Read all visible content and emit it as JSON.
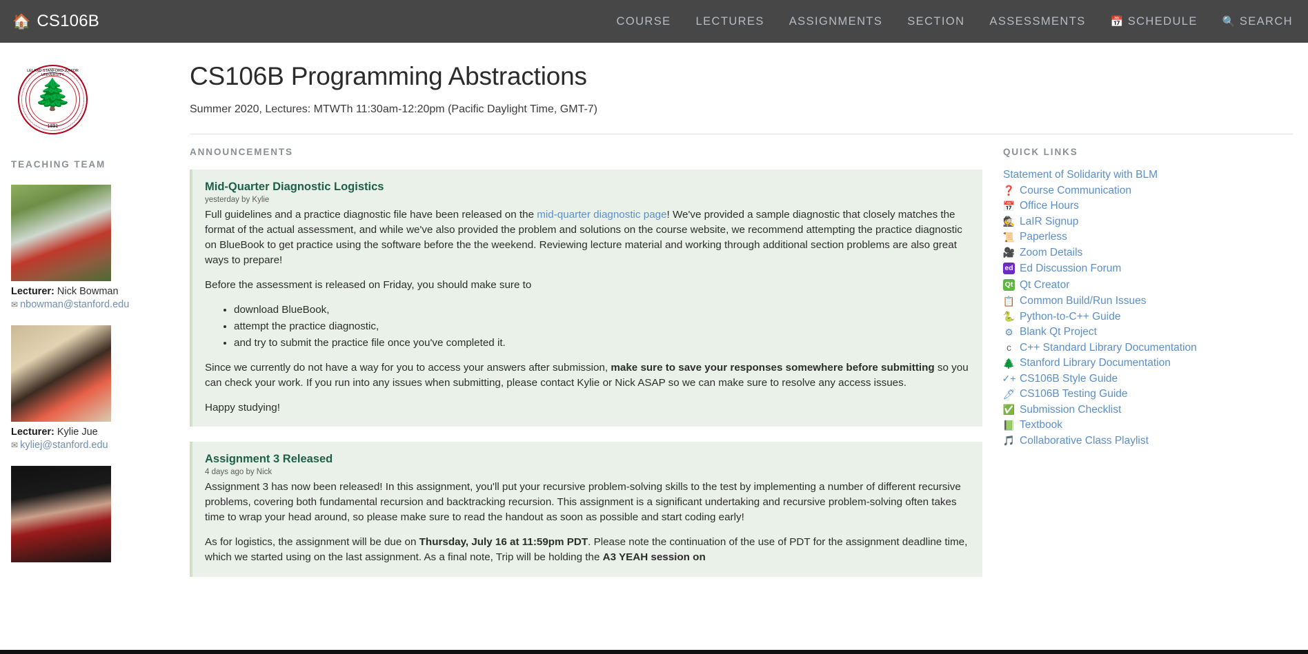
{
  "topnav": {
    "brand": "CS106B",
    "brand_icon": "house-icon",
    "links": [
      {
        "label": "COURSE",
        "icon": ""
      },
      {
        "label": "LECTURES",
        "icon": ""
      },
      {
        "label": "ASSIGNMENTS",
        "icon": ""
      },
      {
        "label": "SECTION",
        "icon": ""
      },
      {
        "label": "ASSESSMENTS",
        "icon": ""
      },
      {
        "label": "SCHEDULE",
        "icon": "📅"
      },
      {
        "label": "SEARCH",
        "icon": "🔍"
      }
    ]
  },
  "sidebar": {
    "logo": {
      "name": "stanford-seal",
      "top_text": "LELAND STANFORD JUNIOR UNIVERSITY",
      "bottom_text": "1891"
    },
    "heading": "TEACHING TEAM",
    "people": [
      {
        "role": "Lecturer:",
        "name": "Nick Bowman",
        "email": "nbowman@stanford.edu",
        "photo_class": "ph-bowman"
      },
      {
        "role": "Lecturer:",
        "name": "Kylie Jue",
        "email": "kyliej@stanford.edu",
        "photo_class": "ph-jue"
      },
      {
        "role": "",
        "name": "",
        "email": "",
        "photo_class": "ph-trip"
      }
    ]
  },
  "header": {
    "title": "CS106B Programming Abstractions",
    "subtitle": "Summer 2020, Lectures: MTWTh 11:30am-12:20pm (Pacific Daylight Time, GMT-7)"
  },
  "announcements": {
    "heading": "ANNOUNCEMENTS",
    "items": [
      {
        "title": "Mid-Quarter Diagnostic Logistics",
        "meta": "yesterday by Kylie",
        "p1_before": "Full guidelines and a practice diagnostic file have been released on the ",
        "p1_link": "mid-quarter diagnostic page",
        "p1_after": "! We've provided a sample diagnostic that closely matches the format of the actual assessment, and while we've also provided the problem and solutions on the course website, we recommend attempting the practice diagnostic on BlueBook to get practice using the software before the the weekend. Reviewing lecture material and working through additional section problems are also great ways to prepare!",
        "p2": "Before the assessment is released on Friday, you should make sure to",
        "bullets": [
          "download BlueBook,",
          "attempt the practice diagnostic,",
          "and try to submit the practice file once you've completed it."
        ],
        "p3_before": "Since we currently do not have a way for you to access your answers after submission, ",
        "p3_bold": "make sure to save your responses somewhere before submitting",
        "p3_after": " so you can check your work. If you run into any issues when submitting, please contact Kylie or Nick ASAP so we can make sure to resolve any access issues.",
        "p4": "Happy studying!"
      },
      {
        "title": "Assignment 3 Released",
        "meta": "4 days ago by Nick",
        "p1": "Assignment 3 has now been released! In this assignment, you'll put your recursive problem-solving skills to the test by implementing a number of different recursive problems, covering both fundamental recursion and backtracking recursion. This assignment is a significant undertaking and recursive problem-solving often takes time to wrap your head around, so please make sure to read the handout as soon as possible and start coding early!",
        "p2_before": "As for logistics, the assignment will be due on ",
        "p2_bold": "Thursday, July 16 at 11:59pm PDT",
        "p2_after": ". Please note the continuation of the use of PDT for the assignment deadline time, which we started using on the last assignment. As a final note, Trip will be holding the ",
        "p2_bold2": "A3 YEAH session on"
      }
    ]
  },
  "quick_links": {
    "heading": "QUICK LINKS",
    "items": [
      {
        "icon": "",
        "icon_name": "none",
        "label": "Statement of Solidarity with BLM"
      },
      {
        "icon": "❓",
        "icon_name": "question-mark-icon",
        "label": "Course Communication"
      },
      {
        "icon": "📅",
        "icon_name": "calendar-icon",
        "label": "Office Hours"
      },
      {
        "icon": "🕵",
        "icon_name": "detective-icon",
        "label": "LaIR Signup"
      },
      {
        "icon": "📜",
        "icon_name": "scroll-icon",
        "label": "Paperless"
      },
      {
        "icon": "🎥",
        "icon_name": "video-camera-icon",
        "label": "Zoom Details"
      },
      {
        "icon": "ed",
        "icon_name": "ed-badge-icon",
        "label": "Ed Discussion Forum"
      },
      {
        "icon": "Qt",
        "icon_name": "qt-badge-icon",
        "label": "Qt Creator"
      },
      {
        "icon": "📋",
        "icon_name": "clipboard-icon",
        "label": "Common Build/Run Issues"
      },
      {
        "icon": "🐍",
        "icon_name": "snake-icon",
        "label": "Python-to-C++ Guide"
      },
      {
        "icon": "⚙",
        "icon_name": "gear-icon",
        "label": "Blank Qt Project"
      },
      {
        "icon": "c",
        "icon_name": "letter-c-icon",
        "label": "C++ Standard Library Documentation"
      },
      {
        "icon": "🌲",
        "icon_name": "evergreen-tree-icon",
        "label": "Stanford Library Documentation"
      },
      {
        "icon": "✓+",
        "icon_name": "checkmark-plus-icon",
        "label": "CS106B Style Guide"
      },
      {
        "icon": "🖊",
        "icon_name": "pen-icon",
        "label": "CS106B Testing Guide"
      },
      {
        "icon": "✅",
        "icon_name": "green-check-icon",
        "label": "Submission Checklist"
      },
      {
        "icon": "📗",
        "icon_name": "green-book-icon",
        "label": "Textbook"
      },
      {
        "icon": "🎵",
        "icon_name": "music-note-icon",
        "label": "Collaborative Class Playlist"
      }
    ]
  },
  "colors": {
    "nav_bg": "#474747",
    "accent_link": "#5b8fc9",
    "announcement_bg": "#eaf1e8",
    "announcement_title": "#1c5f4a",
    "stanford_red": "#b1001a"
  }
}
